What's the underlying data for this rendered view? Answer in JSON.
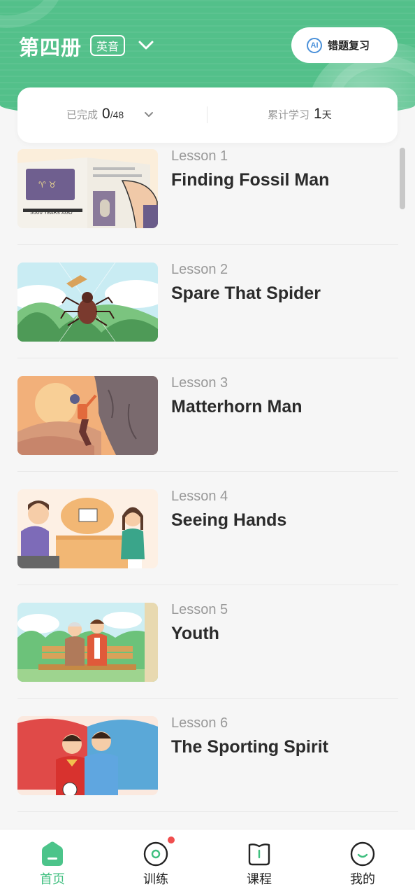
{
  "header": {
    "book_title": "第四册",
    "accent_badge": "英音",
    "ai_review_label": "错题复习",
    "ai_icon_text": "AI"
  },
  "stats": {
    "completed_label": "已完成",
    "completed_value": "0",
    "completed_total": "/48",
    "study_label": "累计学习",
    "study_days": "1",
    "study_unit": "天"
  },
  "lessons": [
    {
      "number": "Lesson 1",
      "title": "Finding Fossil Man",
      "thumb": "book-illustration"
    },
    {
      "number": "Lesson 2",
      "title": "Spare That Spider",
      "thumb": "spider-illustration"
    },
    {
      "number": "Lesson 3",
      "title": "Matterhorn Man",
      "thumb": "climber-illustration"
    },
    {
      "number": "Lesson 4",
      "title": "Seeing Hands",
      "thumb": "reading-illustration"
    },
    {
      "number": "Lesson 5",
      "title": "Youth",
      "thumb": "bench-illustration"
    },
    {
      "number": "Lesson 6",
      "title": "The Sporting Spirit",
      "thumb": "sports-illustration"
    }
  ],
  "tabs": [
    {
      "label": "首页",
      "icon": "home-icon",
      "active": true
    },
    {
      "label": "训练",
      "icon": "target-icon",
      "badge": true
    },
    {
      "label": "课程",
      "icon": "book-icon"
    },
    {
      "label": "我的",
      "icon": "smile-icon"
    }
  ],
  "colors": {
    "brand_green": "#53c08a",
    "active_tab": "#3fbf7f",
    "ai_blue": "#4a90d9",
    "badge_red": "#f04e4e"
  }
}
